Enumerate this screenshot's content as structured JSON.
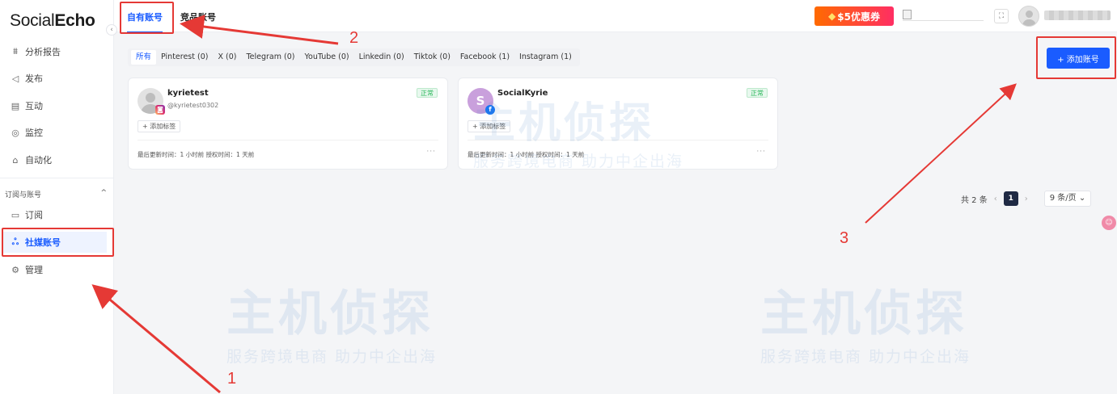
{
  "sidebar": {
    "logo_light": "Social",
    "logo_bold": "Echo",
    "collapse_icon": "‹",
    "items": [
      {
        "label": "分析报告",
        "icon": "chart-icon",
        "glyph": "⩩"
      },
      {
        "label": "发布",
        "icon": "send-icon",
        "glyph": "◁"
      },
      {
        "label": "互动",
        "icon": "message-icon",
        "glyph": "▤"
      },
      {
        "label": "监控",
        "icon": "monitor-icon",
        "glyph": "◎"
      },
      {
        "label": "自动化",
        "icon": "robot-icon",
        "glyph": "⌂"
      }
    ],
    "group_label": "订阅与账号",
    "group_toggle": "^",
    "group_items": [
      {
        "label": "订阅",
        "icon": "card-icon",
        "glyph": "▭"
      },
      {
        "label": "社媒账号",
        "icon": "users-icon",
        "glyph": "ஃ"
      }
    ],
    "manage": {
      "label": "管理",
      "icon": "gear-icon",
      "glyph": "⚙"
    }
  },
  "topbar": {
    "tabs": [
      "自有账号",
      "竞品账号"
    ],
    "promo": "$5优惠券",
    "promo_icon": "◆",
    "fullscreen_icon": "⛶"
  },
  "filters": [
    "所有",
    "Pinterest (0)",
    "X (0)",
    "Telegram (0)",
    "YouTube (0)",
    "Linkedin (0)",
    "Tiktok (0)",
    "Facebook (1)",
    "Instagram (1)"
  ],
  "add_account_label": "+ 添加账号",
  "accounts": [
    {
      "name": "kyrietest",
      "handle": "@kyrietest0302",
      "status": "正常",
      "platform": "instagram",
      "platform_glyph": "◙",
      "add_tag": "+ 添加标签",
      "meta": "最后更新时间：1 小时前    授权时间：1 天前",
      "more": "···"
    },
    {
      "name": "SocialKyrie",
      "handle": "",
      "initial": "S",
      "status": "正常",
      "platform": "facebook",
      "platform_glyph": "f",
      "add_tag": "+ 添加标签",
      "meta": "最后更新时间：1 小时前    授权时间：1 天前",
      "more": "···"
    }
  ],
  "pagination": {
    "total": "共 2 条",
    "prev": "‹",
    "page": "1",
    "next": "›",
    "page_size": "9 条/页  ⌄"
  },
  "float_icon": "☺",
  "annotations": [
    "1",
    "2",
    "3"
  ],
  "annotation_color": "#e53935",
  "accent_color": "#1a5cff",
  "watermark": {
    "big": "主机侦探",
    "small": "服务跨境电商 助力中企出海"
  }
}
